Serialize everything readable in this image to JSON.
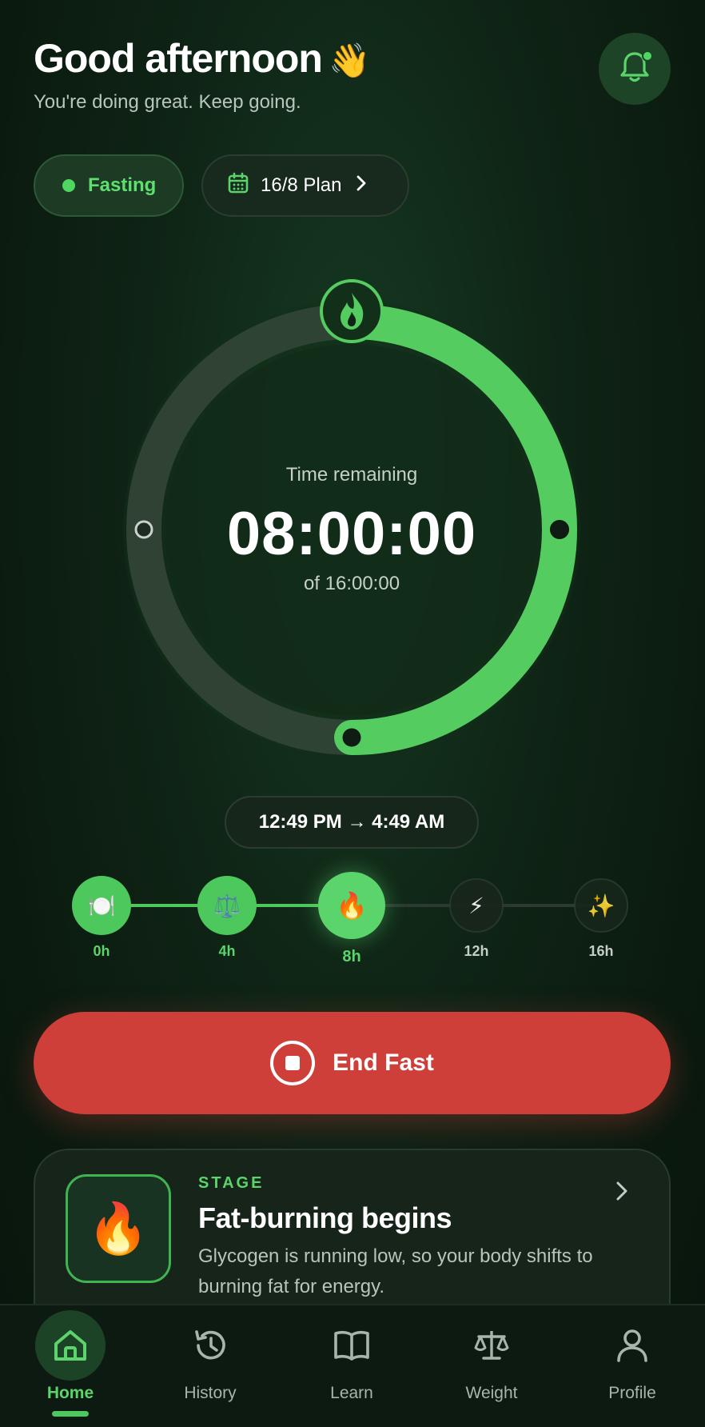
{
  "header": {
    "greeting": "Good afternoon",
    "wave_emoji": "👋",
    "subtitle": "You're doing great. Keep going.",
    "notifications_icon": "bell-icon"
  },
  "status": {
    "fasting_label": "Fasting",
    "plan_label": "16/8 Plan",
    "plan_icon": "calendar-icon"
  },
  "timer": {
    "caption": "Time remaining",
    "remaining": "08:00:00",
    "total": "of 16:00:00",
    "progress": 0.5,
    "top_icon": "flame-icon"
  },
  "range": {
    "text": "12:49 PM → 4:49 AM"
  },
  "stages": [
    {
      "label": "0h",
      "icon": "🍽️",
      "icon_name": "plate-icon",
      "state": "done"
    },
    {
      "label": "4h",
      "icon": "⚖️",
      "icon_name": "scale-icon",
      "state": "done"
    },
    {
      "label": "8h",
      "icon": "🔥",
      "icon_name": "fire-icon",
      "state": "current"
    },
    {
      "label": "12h",
      "icon": "⚡",
      "icon_name": "lightning-icon",
      "state": "todo"
    },
    {
      "label": "16h",
      "icon": "✨",
      "icon_name": "sparkles-icon",
      "state": "todo"
    }
  ],
  "end_fast": {
    "label": "End Fast",
    "icon": "stop-icon"
  },
  "stage_card": {
    "kicker": "STAGE",
    "title": "Fat-burning begins",
    "description": "Glycogen is running low, so your body shifts to burning fat for energy.",
    "icon": "🔥"
  },
  "nav": {
    "items": [
      {
        "label": "Home",
        "icon": "home-icon",
        "active": true
      },
      {
        "label": "History",
        "icon": "history-icon",
        "active": false
      },
      {
        "label": "Learn",
        "icon": "book-icon",
        "active": false
      },
      {
        "label": "Weight",
        "icon": "scale-icon",
        "active": false
      },
      {
        "label": "Profile",
        "icon": "person-icon",
        "active": false
      }
    ]
  },
  "colors": {
    "accent_green": "#4cc85c",
    "danger_red": "#cd3f38",
    "background": "#0c1a10"
  }
}
